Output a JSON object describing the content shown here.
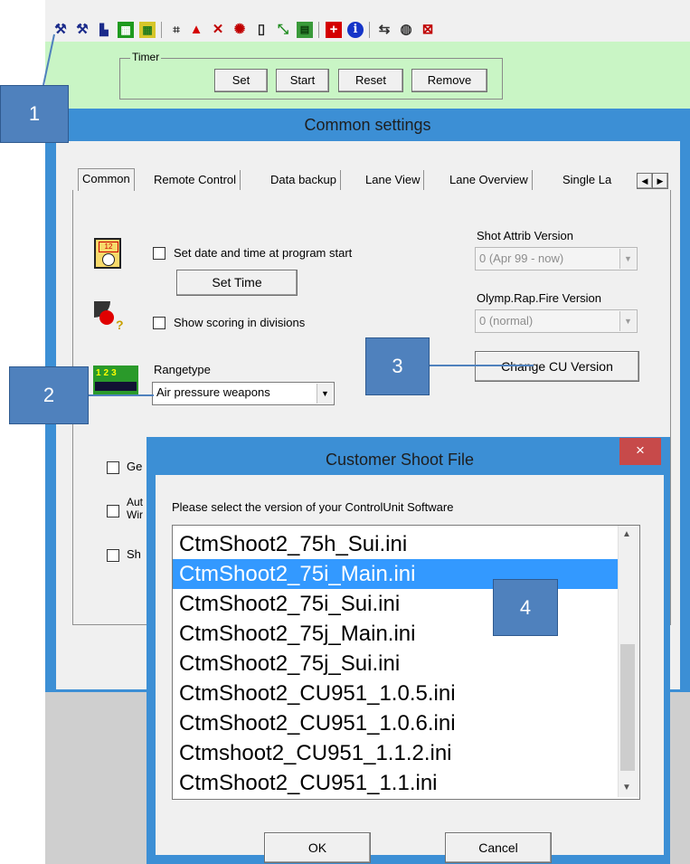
{
  "toolbar": {
    "icons": [
      "wrench-icon",
      "wrench-arrow-icon",
      "tool-bars-icon",
      "grid-green-icon",
      "grid-yellow-icon",
      "lane-grid-icon",
      "warning-triangle-icon",
      "cross-tools-icon",
      "bug-icon",
      "page-icon",
      "diagonal-icon",
      "windows-icon",
      "red-plus-icon",
      "info-icon",
      "transfer-icon",
      "globe-icon",
      "stop-icon"
    ]
  },
  "timer": {
    "title": "Timer",
    "buttons": {
      "set": "Set",
      "start": "Start",
      "reset": "Reset",
      "remove": "Remove"
    }
  },
  "window": {
    "title": "Common settings",
    "tabs": [
      "Common",
      "Remote Control",
      "Data backup",
      "Lane View",
      "Lane Overview",
      "Single La"
    ],
    "set_date_label": "Set date and time at program start",
    "set_time_button": "Set Time",
    "show_scoring_label": "Show scoring in divisions",
    "rangetype_label": "Rangetype",
    "rangetype_value": "Air pressure weapons",
    "shot_attrib_label": "Shot Attrib Version",
    "shot_attrib_value": "0 (Apr 99 - now)",
    "olymp_label": "Olymp.Rap.Fire Version",
    "olymp_value": "0 (normal)",
    "change_cu_button": "Change CU Version",
    "partial_labels": [
      "Ge",
      "Aut",
      "Wir",
      "Sh"
    ]
  },
  "dialog": {
    "title": "Customer Shoot File",
    "close": "×",
    "prompt": "Please select the version of your ControlUnit Software",
    "items": [
      "CtmShoot2_75h_Sui.ini",
      "CtmShoot2_75i_Main.ini",
      "CtmShoot2_75i_Sui.ini",
      "CtmShoot2_75j_Main.ini",
      "CtmShoot2_75j_Sui.ini",
      "CtmShoot2_CU951_1.0.5.ini",
      "CtmShoot2_CU951_1.0.6.ini",
      "Ctmshoot2_CU951_1.1.2.ini",
      "CtmShoot2_CU951_1.1.ini"
    ],
    "selected_index": 1,
    "ok": "OK",
    "cancel": "Cancel"
  },
  "callouts": [
    "1",
    "2",
    "3",
    "4"
  ],
  "colors": {
    "accent_blue": "#3c8fd5",
    "timer_green": "#c9f5c5",
    "selection": "#3399ff",
    "callout": "#4f81bd",
    "close_red": "#c74a4a"
  }
}
